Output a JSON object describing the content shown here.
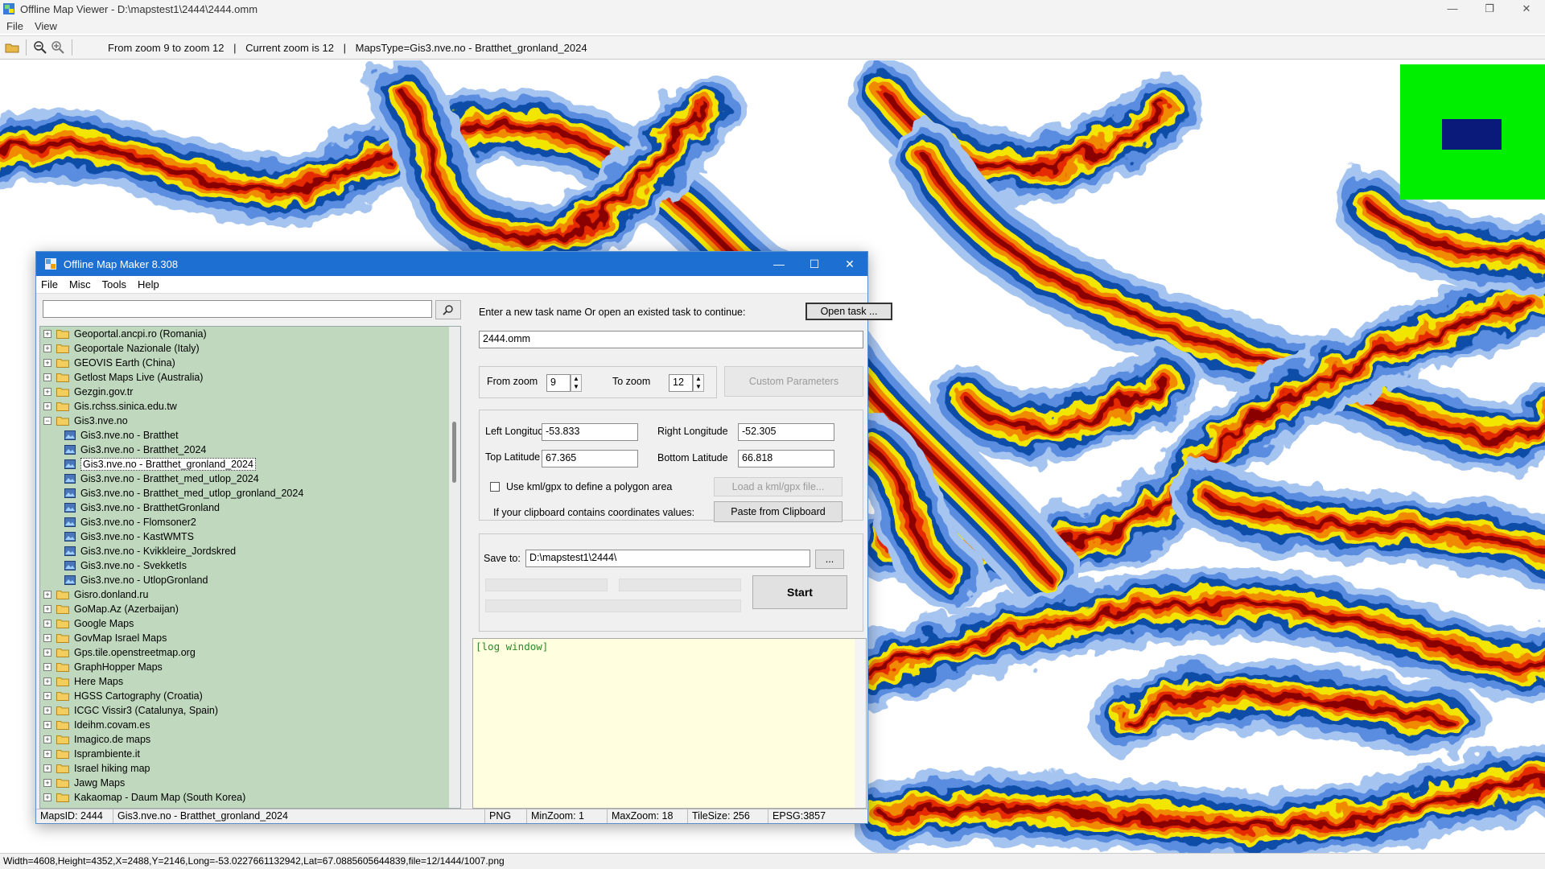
{
  "viewer": {
    "title": "Offline Map Viewer - D:\\mapstest1\\2444\\2444.omm",
    "window_controls": [
      "—",
      "❐",
      "✕"
    ],
    "menu": [
      "File",
      "View"
    ],
    "toolbar": {
      "zoom_range": "From zoom 9 to zoom 12",
      "sep1": "|",
      "current_zoom": "Current zoom is 12",
      "sep2": "|",
      "maps_type": "MapsType=Gis3.nve.no - Bratthet_gronland_2024"
    },
    "status": "Width=4608,Height=4352,X=2488,Y=2146,Long=-53.0227661132942,Lat=67.0885605644839,file=12/1444/1007.png"
  },
  "dialog": {
    "title": "Offline Map Maker 8.308",
    "window_controls": [
      "—",
      "☐",
      "✕"
    ],
    "menu": [
      "File",
      "Misc",
      "Tools",
      "Help"
    ],
    "search": {
      "value": "",
      "icon": "magnifier-icon"
    },
    "tree": {
      "items": [
        {
          "label": "Geoportal.ancpi.ro (Romania)",
          "type": "folder"
        },
        {
          "label": "Geoportale Nazionale (Italy)",
          "type": "folder"
        },
        {
          "label": "GEOVIS Earth (China)",
          "type": "folder"
        },
        {
          "label": "Getlost Maps Live (Australia)",
          "type": "folder"
        },
        {
          "label": "Gezgin.gov.tr",
          "type": "folder"
        },
        {
          "label": "Gis.rchss.sinica.edu.tw",
          "type": "folder"
        },
        {
          "label": "Gis3.nve.no",
          "type": "open-folder"
        },
        {
          "label": "Gis3.nve.no - Bratthet",
          "type": "child"
        },
        {
          "label": "Gis3.nve.no - Bratthet_2024",
          "type": "child"
        },
        {
          "label": "Gis3.nve.no - Bratthet_gronland_2024",
          "type": "child",
          "selected": true
        },
        {
          "label": "Gis3.nve.no - Bratthet_med_utlop_2024",
          "type": "child"
        },
        {
          "label": "Gis3.nve.no - Bratthet_med_utlop_gronland_2024",
          "type": "child"
        },
        {
          "label": "Gis3.nve.no - BratthetGronland",
          "type": "child"
        },
        {
          "label": "Gis3.nve.no - Flomsoner2",
          "type": "child"
        },
        {
          "label": "Gis3.nve.no - KastWMTS",
          "type": "child"
        },
        {
          "label": "Gis3.nve.no - Kvikkleire_Jordskred",
          "type": "child"
        },
        {
          "label": "Gis3.nve.no - SvekketIs",
          "type": "child"
        },
        {
          "label": "Gis3.nve.no - UtlopGronland",
          "type": "child"
        },
        {
          "label": "Gisro.donland.ru",
          "type": "folder"
        },
        {
          "label": "GoMap.Az (Azerbaijan)",
          "type": "folder"
        },
        {
          "label": "Google Maps",
          "type": "folder"
        },
        {
          "label": "GovMap Israel Maps",
          "type": "folder"
        },
        {
          "label": "Gps.tile.openstreetmap.org",
          "type": "folder"
        },
        {
          "label": "GraphHopper Maps",
          "type": "folder"
        },
        {
          "label": "Here Maps",
          "type": "folder"
        },
        {
          "label": "HGSS Cartography (Croatia)",
          "type": "folder"
        },
        {
          "label": "ICGC Vissir3 (Catalunya, Spain)",
          "type": "folder"
        },
        {
          "label": "Ideihm.covam.es",
          "type": "folder"
        },
        {
          "label": "Imagico.de maps",
          "type": "folder"
        },
        {
          "label": "Isprambiente.it",
          "type": "folder"
        },
        {
          "label": "Israel hiking map",
          "type": "folder"
        },
        {
          "label": "Jawg Maps",
          "type": "folder"
        },
        {
          "label": "Kakaomap - Daum Map (South Korea)",
          "type": "folder"
        }
      ]
    },
    "task": {
      "prompt": "Enter a new task name Or open an existed task to continue:",
      "open_button": "Open task ...",
      "name_value": "2444.omm"
    },
    "zoom": {
      "from_label": "From zoom",
      "from_value": "9",
      "to_label": "To zoom",
      "to_value": "12",
      "custom_button": "Custom Parameters"
    },
    "coords": {
      "left_lon_label": "Left Longitude",
      "left_lon_value": "-53.833",
      "right_lon_label": "Right Longitude",
      "right_lon_value": "-52.305",
      "top_lat_label": "Top Latitude",
      "top_lat_value": "67.365",
      "bottom_lat_label": "Bottom Latitude",
      "bottom_lat_value": "66.818",
      "kml_label": "Use kml/gpx to define a polygon area",
      "kml_button": "Load a kml/gpx file...",
      "clipboard_label": "If your clipboard contains coordinates values:",
      "clipboard_button": "Paste from Clipboard"
    },
    "save": {
      "label": "Save to:",
      "value": "D:\\mapstest1\\2444\\",
      "browse_button": "...",
      "start_button": "Start"
    },
    "log": {
      "text": "[log window]"
    },
    "status": {
      "maps_id": "MapsID: 2444",
      "map_name": "Gis3.nve.no - Bratthet_gronland_2024",
      "format": "PNG",
      "min_zoom": "MinZoom: 1",
      "max_zoom": "MaxZoom: 18",
      "tile_size": "TileSize: 256",
      "epsg": "EPSG:3857"
    }
  },
  "colors": {
    "map_bands": [
      "#a6c4f0",
      "#5a8de0",
      "#0b4ea8",
      "#f2e600",
      "#f08a00",
      "#e62a00",
      "#8a0000"
    ],
    "tree_bg": "#c0d9be",
    "log_bg": "#ffffdf",
    "dialog_title": "#1d6fd1"
  }
}
